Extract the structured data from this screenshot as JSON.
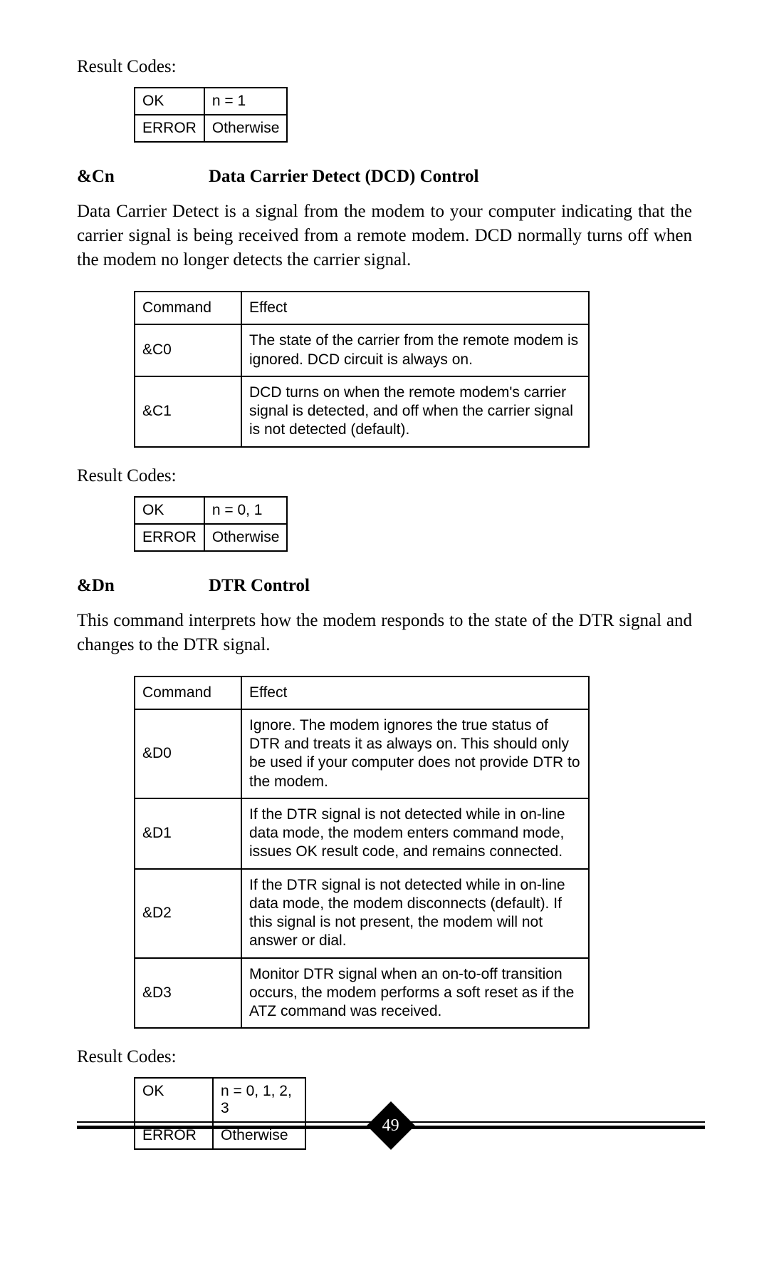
{
  "labels": {
    "result_codes": "Result Codes:",
    "command_header": "Command",
    "effect_header": "Effect"
  },
  "section1": {
    "result_rows": [
      {
        "code": "OK",
        "cond": "n = 1"
      },
      {
        "code": "ERROR",
        "cond": "Otherwise"
      }
    ]
  },
  "section2": {
    "cmd": "&Cn",
    "title": "Data Carrier Detect (DCD) Control",
    "para": "Data Carrier Detect is a signal from the modem to your computer indicating that the carrier signal is being received from a remote modem. DCD normally turns off when the modem no longer detects the carrier signal.",
    "rows": [
      {
        "cmd": "&C0",
        "effect": "The state of the carrier from the remote modem is ignored. DCD circuit is always on."
      },
      {
        "cmd": "&C1",
        "effect": "DCD turns on when the remote modem's carrier signal is detected, and off when the carrier signal is not detected (default)."
      }
    ],
    "result_rows": [
      {
        "code": "OK",
        "cond": "n = 0, 1"
      },
      {
        "code": "ERROR",
        "cond": "Otherwise"
      }
    ]
  },
  "section3": {
    "cmd": "&Dn",
    "title": "DTR Control",
    "para": "This command interprets how the modem responds to the state of the DTR signal and changes to the DTR signal.",
    "rows": [
      {
        "cmd": "&D0",
        "effect": "Ignore. The modem ignores the true status of DTR and treats it as always on. This should only be used if your computer does not provide DTR to the modem."
      },
      {
        "cmd": "&D1",
        "effect": "If the DTR signal is not detected while in on-line data mode, the modem enters command mode, issues OK result code, and remains connected."
      },
      {
        "cmd": "&D2",
        "effect": "If the DTR signal is not detected while in on-line data mode, the modem disconnects (default). If this signal is not present, the modem will not answer or dial."
      },
      {
        "cmd": "&D3",
        "effect": "Monitor DTR signal when an on-to-off transition occurs, the modem performs a soft reset as if the ATZ command was received."
      }
    ],
    "result_rows": [
      {
        "code": "OK",
        "cond": "n = 0, 1, 2, 3"
      },
      {
        "code": "ERROR",
        "cond": "Otherwise"
      }
    ]
  },
  "page_number": "49"
}
